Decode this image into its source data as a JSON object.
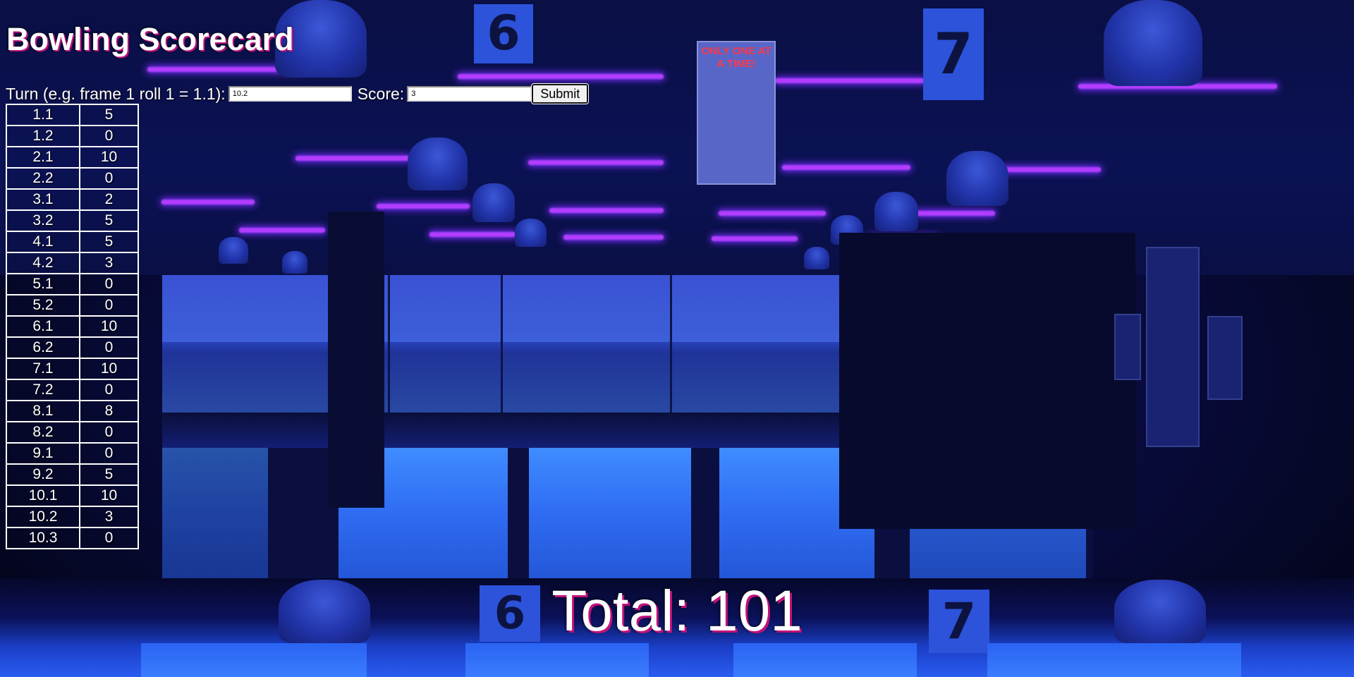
{
  "app": {
    "title": "Bowling Scorecard"
  },
  "form": {
    "turn_label": "Turn (e.g. frame 1 roll 1 = 1.1):",
    "turn_value": "10.2",
    "score_label": "Score:",
    "score_value": "3",
    "submit_label": "Submit"
  },
  "rolls": [
    {
      "turn": "1.1",
      "score": "5"
    },
    {
      "turn": "1.2",
      "score": "0"
    },
    {
      "turn": "2.1",
      "score": "10"
    },
    {
      "turn": "2.2",
      "score": "0"
    },
    {
      "turn": "3.1",
      "score": "2"
    },
    {
      "turn": "3.2",
      "score": "5"
    },
    {
      "turn": "4.1",
      "score": "5"
    },
    {
      "turn": "4.2",
      "score": "3"
    },
    {
      "turn": "5.1",
      "score": "0"
    },
    {
      "turn": "5.2",
      "score": "0"
    },
    {
      "turn": "6.1",
      "score": "10"
    },
    {
      "turn": "6.2",
      "score": "0"
    },
    {
      "turn": "7.1",
      "score": "10"
    },
    {
      "turn": "7.2",
      "score": "0"
    },
    {
      "turn": "8.1",
      "score": "8"
    },
    {
      "turn": "8.2",
      "score": "0"
    },
    {
      "turn": "9.1",
      "score": "0"
    },
    {
      "turn": "9.2",
      "score": "5"
    },
    {
      "turn": "10.1",
      "score": "10"
    },
    {
      "turn": "10.2",
      "score": "3"
    },
    {
      "turn": "10.3",
      "score": "0"
    }
  ],
  "total": {
    "text": "Total: 101"
  },
  "background": {
    "lane_sign_numbers": [
      "6",
      "7"
    ],
    "warning_sign_text": "ONLY ONE AT A TIME!"
  },
  "colors": {
    "text": "#ffffff",
    "title_shadow": "#c0127a",
    "neon_beam": "#b23cff",
    "lane_blue": "#2f6cf2"
  }
}
